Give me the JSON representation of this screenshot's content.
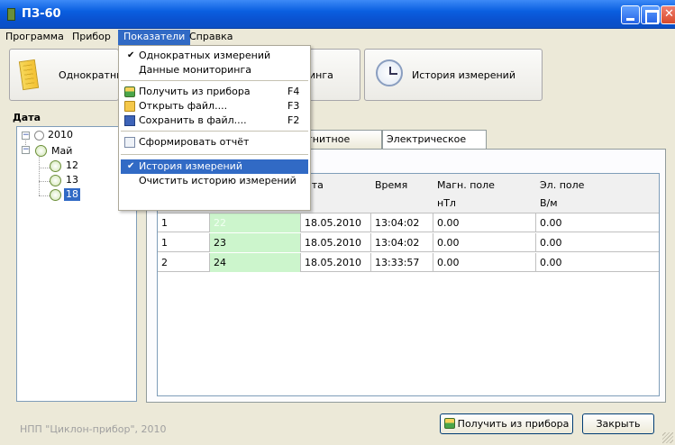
{
  "window": {
    "title": "ПЗ-60"
  },
  "menubar": [
    "Программа",
    "Прибор",
    "Показатели",
    "Справка"
  ],
  "toolbar": {
    "single_label": "Однократных",
    "monitoring_partial": "инга",
    "history_label": "История измерений"
  },
  "dropdown": {
    "items": [
      {
        "label": "Однократных измерений",
        "checked": true
      },
      {
        "label": "Данные мониторинга",
        "checked": false
      },
      {
        "label": "Получить из прибора",
        "shortcut": "F4"
      },
      {
        "label": "Открыть файл....",
        "shortcut": "F3"
      },
      {
        "label": "Сохранить в файл....",
        "shortcut": "F2"
      },
      {
        "label": "Сформировать отчёт"
      },
      {
        "label": "История измерений",
        "checked": true
      },
      {
        "label": "Очистить историю измерений"
      }
    ]
  },
  "tree": {
    "header": "Дата",
    "year": "2010",
    "month": "Май",
    "days": [
      "12",
      "13",
      "18"
    ],
    "selected_day": "18"
  },
  "tabs": [
    "гнитное поле",
    "Электрическое поле"
  ],
  "table": {
    "headers": {
      "date": "ата",
      "time": "Время",
      "mag": "Магн. поле",
      "mag_unit": "нТл",
      "el": "Эл. поле",
      "el_unit": "В/м"
    },
    "rows": [
      [
        "1",
        "22",
        "18.05.2010",
        "13:04:02",
        "0.00",
        "0.00"
      ],
      [
        "1",
        "23",
        "18.05.2010",
        "13:04:02",
        "0.00",
        "0.00"
      ],
      [
        "2",
        "24",
        "18.05.2010",
        "13:33:57",
        "0.00",
        "0.00"
      ]
    ]
  },
  "footer": {
    "company": "НПП \"Циклон-прибор\", 2010",
    "get_button": "Получить из прибора",
    "close_button": "Закрыть"
  }
}
